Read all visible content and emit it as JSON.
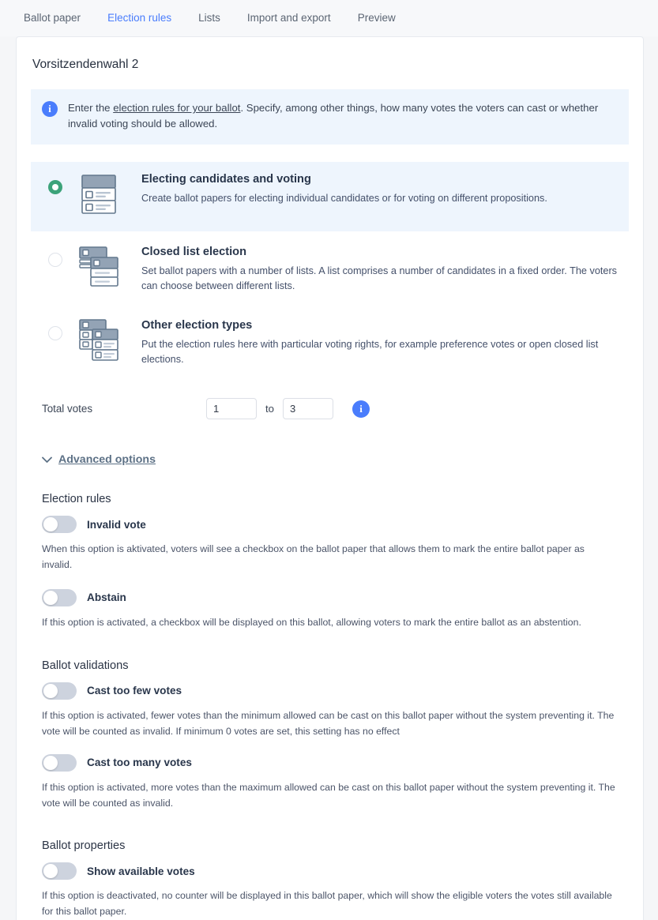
{
  "tabs": [
    {
      "label": "Ballot paper",
      "active": false
    },
    {
      "label": "Election rules",
      "active": true
    },
    {
      "label": "Lists",
      "active": false
    },
    {
      "label": "Import and export",
      "active": false
    },
    {
      "label": "Preview",
      "active": false
    }
  ],
  "page": {
    "title": "Vorsitzendenwahl 2"
  },
  "info_banner": {
    "icon": "info-icon",
    "text_before": "Enter the ",
    "link_text": "election rules for your ballot",
    "text_after": ". Specify, among other things, how many votes the voters can cast or whether invalid voting should be allowed."
  },
  "election_type_options": [
    {
      "id": "electing-candidates-and-voting",
      "title": "Electing candidates and voting",
      "description": "Create ballot papers for electing individual candidates or for voting on different propositions.",
      "selected": true
    },
    {
      "id": "closed-list-election",
      "title": "Closed list election",
      "description": "Set ballot papers with a number of lists. A list comprises a number of candidates in a fixed order. The voters can choose between different lists.",
      "selected": false
    },
    {
      "id": "other-election-types",
      "title": "Other election types",
      "description": "Put the election rules here with particular voting rights, for example preference votes or open closed list elections.",
      "selected": false
    }
  ],
  "total_votes": {
    "label": "Total votes",
    "min_value": "1",
    "separator": "to",
    "max_value": "3",
    "info_icon": "info-icon"
  },
  "advanced_options": {
    "label": "Advanced options",
    "chevron": "chevron-down-icon",
    "expanded": true
  },
  "sections": [
    {
      "id": "election-rules",
      "title": "Election rules",
      "settings": [
        {
          "id": "invalid-vote",
          "label": "Invalid vote",
          "enabled": false,
          "help": "When this option is aktivated, voters will see a checkbox on the ballot paper that allows them to mark the entire ballot paper as invalid."
        },
        {
          "id": "abstain",
          "label": "Abstain",
          "enabled": false,
          "help": "If this option is activated, a checkbox will be displayed on this ballot, allowing voters to mark the entire ballot as an abstention."
        }
      ]
    },
    {
      "id": "ballot-validations",
      "title": "Ballot validations",
      "settings": [
        {
          "id": "cast-too-few-votes",
          "label": "Cast too few votes",
          "enabled": false,
          "help": "If this option is activated, fewer votes than the minimum allowed can be cast on this ballot paper without the system preventing it. The vote will be counted as invalid. If minimum 0 votes are set, this setting has no effect"
        },
        {
          "id": "cast-too-many-votes",
          "label": "Cast too many votes",
          "enabled": false,
          "help": "If this option is activated, more votes than the maximum allowed can be cast on this ballot paper without the system preventing it. The vote will be counted as invalid."
        }
      ]
    },
    {
      "id": "ballot-properties",
      "title": "Ballot properties",
      "settings": [
        {
          "id": "show-available-votes",
          "label": "Show available votes",
          "enabled": false,
          "help": "If this option is deactivated, no counter will be displayed in this ballot paper, which will show the eligible voters the votes still available for this ballot paper."
        }
      ]
    }
  ],
  "colors": {
    "accent_blue": "#4a7dfc",
    "selected_green": "#3ca37a",
    "banner_blue": "#eef5fd",
    "page_background": "#f5f6f8",
    "card_background": "#ffffff",
    "icon_slate": "#77889c"
  }
}
